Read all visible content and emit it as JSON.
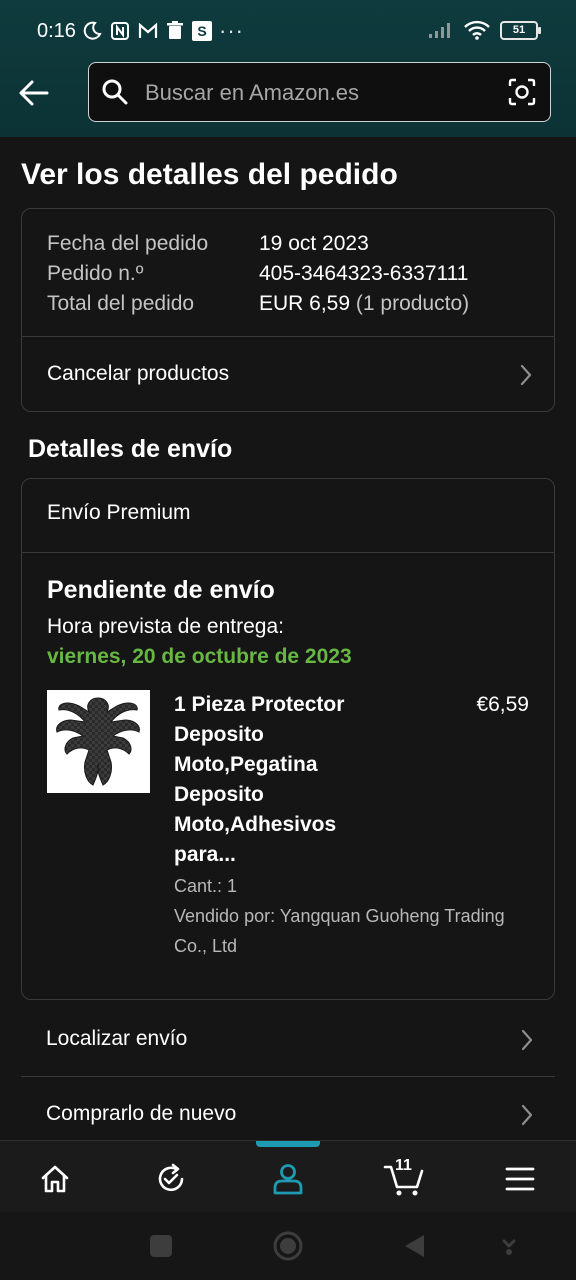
{
  "status_bar": {
    "time": "0:16",
    "more": "···",
    "battery": "51"
  },
  "search": {
    "placeholder": "Buscar en Amazon.es"
  },
  "page": {
    "title": "Ver los detalles del pedido"
  },
  "order_summary": {
    "rows": [
      {
        "label": "Fecha del pedido",
        "value": "19 oct 2023"
      },
      {
        "label": "Pedido n.º",
        "value": "405-3464323-6337111"
      },
      {
        "label": "Total del pedido",
        "value": "EUR 6,59",
        "extra": "(1 producto)"
      }
    ],
    "cancel_label": "Cancelar productos"
  },
  "shipping": {
    "section_title": "Detalles de envío",
    "method": "Envío Premium",
    "status": "Pendiente de envío",
    "delivery_label": "Hora prevista de entrega:",
    "delivery_date": "viernes, 20 de octubre de 2023",
    "product": {
      "name": "1 Pieza Protector Deposito Moto,Pegatina Deposito Moto,Adhesivos para...",
      "price": "€6,59",
      "quantity": "Cant.: 1",
      "seller": "Vendido por: Yangquan Guoheng Trading Co., Ltd"
    }
  },
  "actions": {
    "track": "Localizar envío",
    "buy_again": "Comprarlo de nuevo"
  },
  "bottom_nav": {
    "cart_count": "11",
    "active": "account",
    "accent_color": "#1e9bb2"
  },
  "colors": {
    "delivery_green": "#67b843",
    "header_teal": "#0f3b3e"
  }
}
